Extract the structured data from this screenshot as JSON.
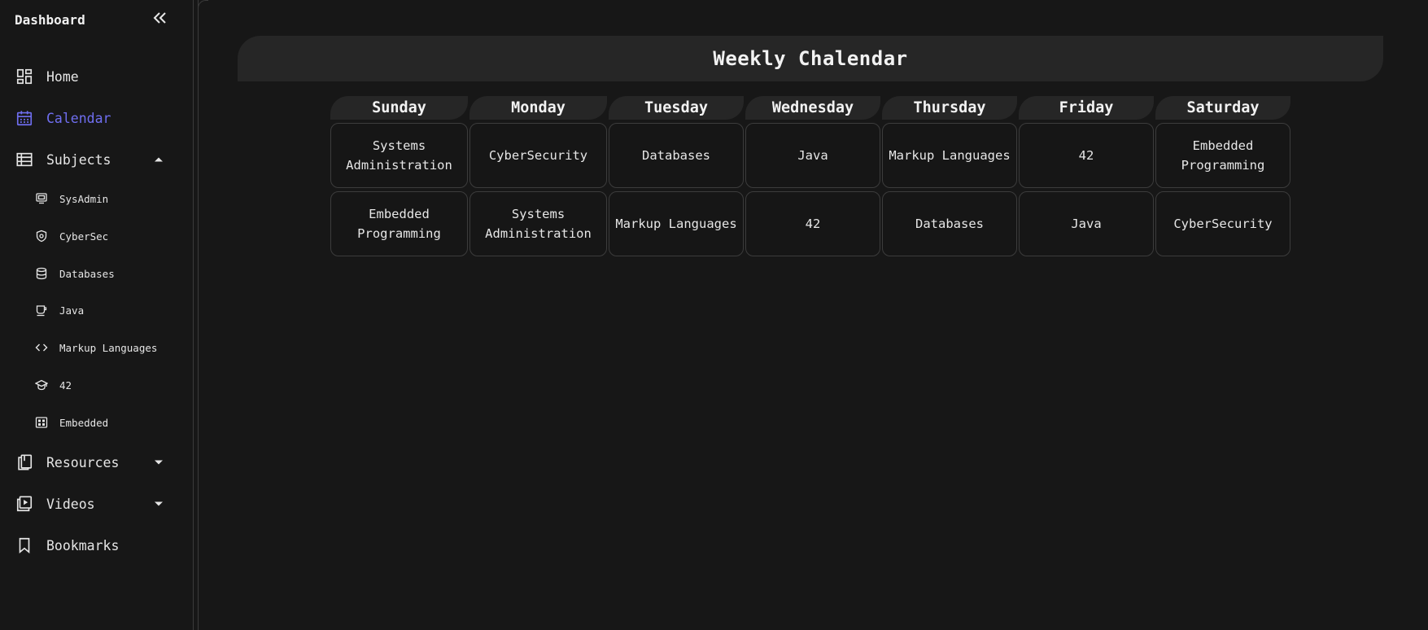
{
  "sidebar": {
    "title": "Dashboard",
    "nav": [
      {
        "label": "Home",
        "icon": "dashboard-icon"
      },
      {
        "label": "Calendar",
        "icon": "calendar-icon",
        "active": true
      },
      {
        "label": "Subjects",
        "icon": "table-icon",
        "expanded": true
      },
      {
        "label": "Resources",
        "icon": "book-icon"
      },
      {
        "label": "Videos",
        "icon": "video-icon"
      },
      {
        "label": "Bookmarks",
        "icon": "bookmark-icon"
      }
    ],
    "subjects": [
      {
        "label": "SysAdmin",
        "icon": "server-icon"
      },
      {
        "label": "CyberSec",
        "icon": "shield-icon"
      },
      {
        "label": "Databases",
        "icon": "database-icon"
      },
      {
        "label": "Java",
        "icon": "coffee-icon"
      },
      {
        "label": "Markup Languages",
        "icon": "code-icon"
      },
      {
        "label": "42",
        "icon": "graduation-cap-icon"
      },
      {
        "label": "Embedded",
        "icon": "chip-icon"
      }
    ],
    "accent_color": "#6f6ef0"
  },
  "main": {
    "title": "Weekly Chalendar",
    "days": [
      "Sunday",
      "Monday",
      "Tuesday",
      "Wednesday",
      "Thursday",
      "Friday",
      "Saturday"
    ],
    "rows": [
      [
        "Systems Administration",
        "CyberSecurity",
        "Databases",
        "Java",
        "Markup Languages",
        "42",
        "Embedded Programming"
      ],
      [
        "Embedded Programming",
        "Systems Administration",
        "Markup Languages",
        "42",
        "Databases",
        "Java",
        "CyberSecurity"
      ]
    ]
  }
}
